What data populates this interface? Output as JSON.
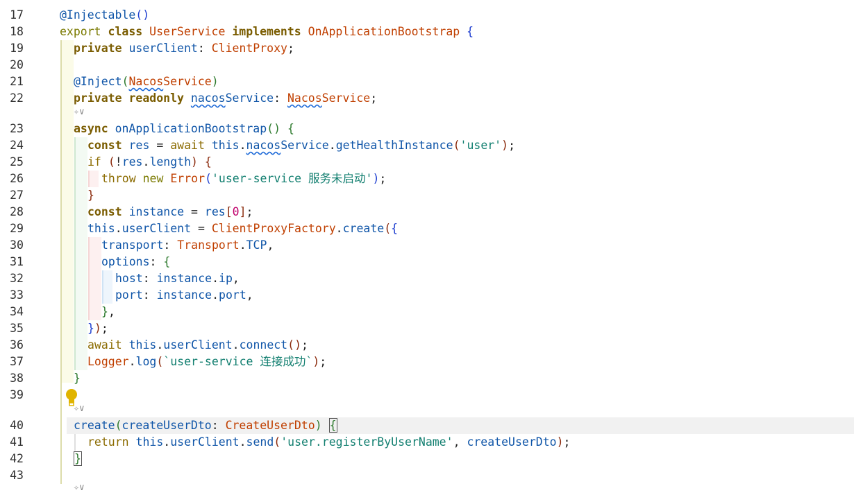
{
  "editor": {
    "line_numbers": [
      "17",
      "18",
      "19",
      "20",
      "21",
      "22",
      "23",
      "24",
      "25",
      "26",
      "27",
      "28",
      "29",
      "30",
      "31",
      "32",
      "33",
      "34",
      "35",
      "36",
      "37",
      "38",
      "39",
      "40",
      "41",
      "42",
      "43"
    ],
    "current_line": "40",
    "tokens": {
      "l17": [
        "@Injectable",
        "(",
        ")"
      ],
      "l18": [
        "export",
        "class",
        "UserService",
        "implements",
        "OnApplicationBootstrap",
        "{"
      ],
      "l19": [
        "private",
        "userClient",
        ":",
        "ClientProxy",
        ";"
      ],
      "l21": [
        "@Inject",
        "(",
        "Nacos",
        "Service",
        ")"
      ],
      "l22": [
        "private",
        "readonly",
        "nacos",
        "Service",
        ":",
        "Nacos",
        "Service",
        ";"
      ],
      "l23": [
        "async",
        "onApplicationBootstrap",
        "(",
        ")",
        "{"
      ],
      "l24": [
        "const",
        "res",
        "=",
        "await",
        "this",
        ".",
        "nacos",
        "Service",
        ".",
        "getHealthInstance",
        "(",
        "'user'",
        ")",
        ";"
      ],
      "l25": [
        "if",
        "(",
        "!",
        "res",
        ".",
        "length",
        ")",
        "{"
      ],
      "l26": [
        "throw",
        "new",
        "Error",
        "(",
        "'user-service 服务未启动'",
        ")",
        ";"
      ],
      "l27": [
        "}"
      ],
      "l28": [
        "const",
        "instance",
        "=",
        "res",
        "[",
        "0",
        "]",
        ";"
      ],
      "l29": [
        "this",
        ".",
        "userClient",
        "=",
        "ClientProxyFactory",
        ".",
        "create",
        "(",
        "{"
      ],
      "l30": [
        "transport",
        ":",
        "Transport",
        ".",
        "TCP",
        ","
      ],
      "l31": [
        "options",
        ":",
        "{"
      ],
      "l32": [
        "host",
        ":",
        "instance",
        ".",
        "ip",
        ","
      ],
      "l33": [
        "port",
        ":",
        "instance",
        ".",
        "port",
        ","
      ],
      "l34": [
        "}",
        ","
      ],
      "l35": [
        "}",
        ")",
        ";"
      ],
      "l36": [
        "await",
        "this",
        ".",
        "userClient",
        ".",
        "connect",
        "(",
        ")",
        ";"
      ],
      "l37": [
        "Logger",
        ".",
        "log",
        "(",
        "`user-service 连接成功`",
        ")",
        ";"
      ],
      "l38": [
        "}"
      ],
      "l40": [
        "create",
        "(",
        "createUserDto",
        ":",
        "CreateUserDto",
        ")",
        "{"
      ],
      "l41": [
        "return",
        "this",
        ".",
        "userClient",
        ".",
        "send",
        "(",
        "'user.registerByUserName'",
        ",",
        "createUserDto",
        ")",
        ";"
      ],
      "l42": [
        "}"
      ]
    },
    "codelens_icon": "copilot-sparkle-icon",
    "codelens_chevron": "chevron-down-icon",
    "lightbulb_icon": "lightbulb-icon"
  },
  "colors": {
    "background": "#ffffff",
    "current_line_highlight": "#f1f1f1",
    "squiggle": "#1e6ad8",
    "lightbulb": "#e0b400"
  }
}
